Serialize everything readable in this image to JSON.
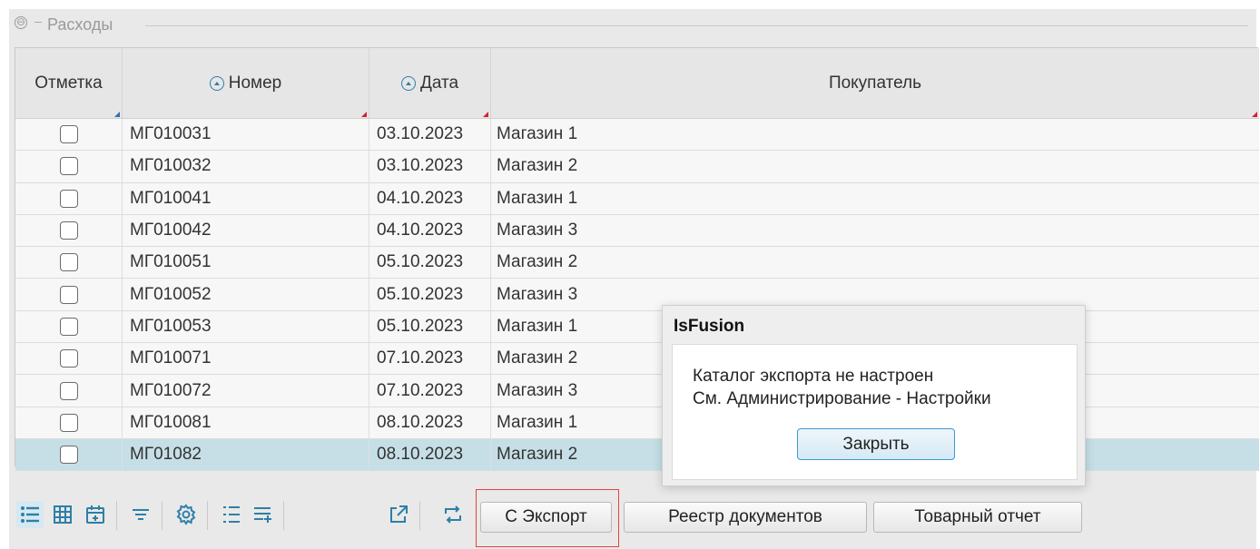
{
  "group": {
    "toggle_symbol": "⊖",
    "title": "Расходы"
  },
  "columns": {
    "mark": "Отметка",
    "number": "Номер",
    "date": "Дата",
    "buyer": "Покупатель"
  },
  "rows": [
    {
      "number": "МГ010031",
      "date": "03.10.2023",
      "buyer": "Магазин 1"
    },
    {
      "number": "МГ010032",
      "date": "03.10.2023",
      "buyer": "Магазин 2"
    },
    {
      "number": "МГ010041",
      "date": "04.10.2023",
      "buyer": "Магазин 1"
    },
    {
      "number": "МГ010042",
      "date": "04.10.2023",
      "buyer": "Магазин 3"
    },
    {
      "number": "МГ010051",
      "date": "05.10.2023",
      "buyer": "Магазин 2"
    },
    {
      "number": "МГ010052",
      "date": "05.10.2023",
      "buyer": "Магазин 3"
    },
    {
      "number": "МГ010053",
      "date": "05.10.2023",
      "buyer": "Магазин 1"
    },
    {
      "number": "МГ010071",
      "date": "07.10.2023",
      "buyer": "Магазин 2"
    },
    {
      "number": "МГ010072",
      "date": "07.10.2023",
      "buyer": "Магазин 3"
    },
    {
      "number": "МГ010081",
      "date": "08.10.2023",
      "buyer": "Магазин 1"
    },
    {
      "number": "МГ01082",
      "date": "08.10.2023",
      "buyer": "Магазин 2"
    }
  ],
  "selected_row_index": 10,
  "toolbar": {
    "icons": [
      "list-view-icon",
      "grid-view-icon",
      "calendar-view-icon",
      "filter-icon",
      "settings-icon",
      "ordered-list-icon",
      "add-list-icon",
      "open-external-icon",
      "sync-icon"
    ],
    "export_label": "С Экспорт",
    "registry_label": "Реестр документов",
    "goods_report_label": "Товарный отчет"
  },
  "dialog": {
    "title": "IsFusion",
    "message_line1": "Каталог экспорта не настроен",
    "message_line2": "См. Администрирование - Настройки",
    "close_label": "Закрыть"
  },
  "colors": {
    "accent": "#2d7fa8",
    "selected_row": "#c6dfe7",
    "highlight": "#e2453b"
  }
}
